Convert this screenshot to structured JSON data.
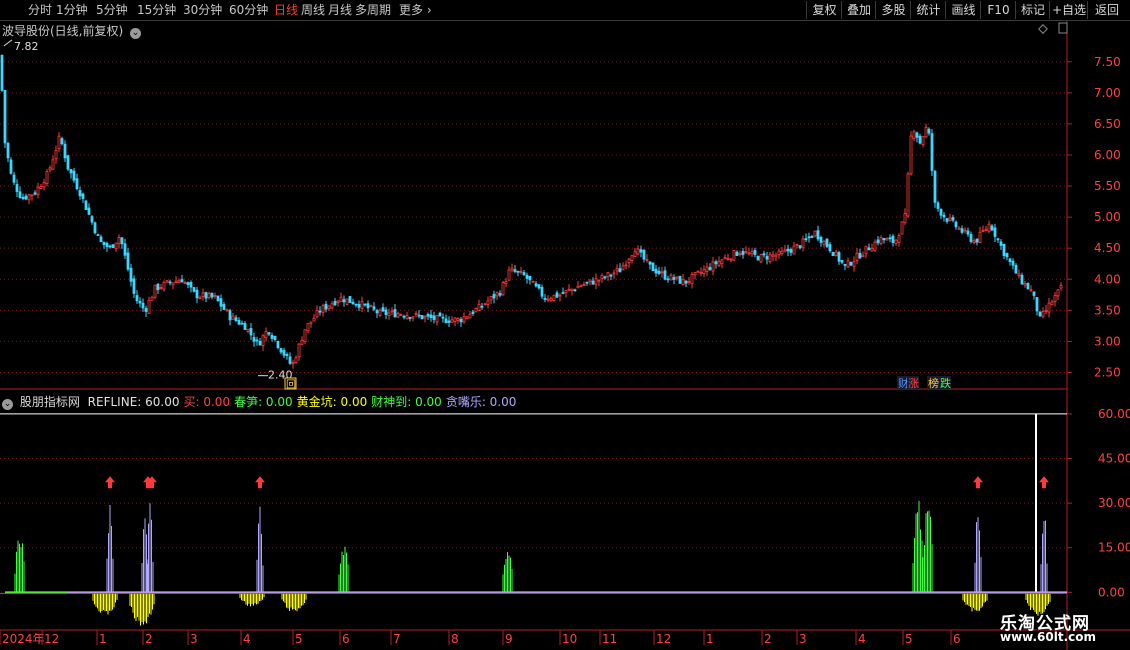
{
  "toolbar": {
    "periods": [
      {
        "label": "分时",
        "active": false
      },
      {
        "label": "1分钟",
        "active": false
      },
      {
        "label": "5分钟",
        "active": false
      },
      {
        "label": "15分钟",
        "active": false
      },
      {
        "label": "30分钟",
        "active": false
      },
      {
        "label": "60分钟",
        "active": false
      },
      {
        "label": "日线",
        "active": true
      },
      {
        "label": "周线",
        "active": false
      },
      {
        "label": "月线",
        "active": false
      },
      {
        "label": "多周期",
        "active": false
      },
      {
        "label": "更多",
        "active": false
      }
    ],
    "actions": [
      "复权",
      "叠加",
      "多股",
      "统计",
      "画线",
      "F10",
      "标记",
      "+自选",
      "返回"
    ],
    "more_icon": "chevron-right-icon"
  },
  "main_panel": {
    "title": "波导股份(日线,前复权)",
    "high_label": "7.82",
    "low_label": "2.40",
    "low_marker": "回",
    "badges": [
      {
        "label": "财",
        "color": "#4f9bff"
      },
      {
        "label": "涨",
        "color": "#ff4040"
      },
      {
        "label": "榜",
        "color": "#ffd040"
      },
      {
        "label": "跌",
        "color": "#40ff40"
      }
    ],
    "y_ticks": [
      "7.50",
      "7.00",
      "6.50",
      "6.00",
      "5.50",
      "5.00",
      "4.50",
      "4.00",
      "3.50",
      "3.00",
      "2.50"
    ]
  },
  "indicator_panel": {
    "name": "股朋指标网",
    "params": [
      {
        "label": "REFLINE: 60.00",
        "color": "#e0e0e0"
      },
      {
        "label": "买: 0.00",
        "color": "#ff4040"
      },
      {
        "label": "春笋: 0.00",
        "color": "#40ff40"
      },
      {
        "label": "黄金坑: 0.00",
        "color": "#ffff00"
      },
      {
        "label": "财神到: 0.00",
        "color": "#40ff40"
      },
      {
        "label": "贪嘴乐: 0.00",
        "color": "#b0a8ff"
      }
    ],
    "y_ticks": [
      "60.00",
      "45.00",
      "30.00",
      "15.00",
      "0.00"
    ]
  },
  "time_axis": {
    "labels": [
      "2024年",
      "12",
      "1",
      "2",
      "3",
      "4",
      "5",
      "6",
      "7",
      "8",
      "9",
      "10",
      "11",
      "12",
      "1",
      "2",
      "3",
      "4",
      "5",
      "6"
    ]
  },
  "watermark": {
    "line1": "乐淘公式网",
    "line2": "www.60lt.com"
  },
  "colors": {
    "up": "#ff3a3a",
    "down": "#3ad7ff",
    "grid": "#7a1a1a",
    "axis": "#b02020",
    "ma": "#ffffff"
  },
  "chart_data": [
    {
      "type": "candlestick",
      "title": "波导股份(日线,前复权)",
      "ylim": [
        2.25,
        7.85
      ],
      "annotations": {
        "high": 7.82,
        "low": 2.4
      },
      "close_path": [
        [
          0,
          7.6
        ],
        [
          5,
          6.2
        ],
        [
          12,
          5.6
        ],
        [
          22,
          5.3
        ],
        [
          35,
          5.4
        ],
        [
          48,
          5.7
        ],
        [
          60,
          6.3
        ],
        [
          68,
          5.8
        ],
        [
          80,
          5.4
        ],
        [
          90,
          5.0
        ],
        [
          100,
          4.6
        ],
        [
          110,
          4.5
        ],
        [
          120,
          4.7
        ],
        [
          135,
          3.7
        ],
        [
          145,
          3.5
        ],
        [
          155,
          3.85
        ],
        [
          170,
          3.95
        ],
        [
          182,
          4.0
        ],
        [
          195,
          3.75
        ],
        [
          215,
          3.7
        ],
        [
          230,
          3.4
        ],
        [
          245,
          3.25
        ],
        [
          258,
          2.95
        ],
        [
          268,
          3.2
        ],
        [
          282,
          2.85
        ],
        [
          292,
          2.6
        ],
        [
          305,
          3.2
        ],
        [
          320,
          3.5
        ],
        [
          340,
          3.7
        ],
        [
          360,
          3.6
        ],
        [
          380,
          3.45
        ],
        [
          400,
          3.45
        ],
        [
          420,
          3.4
        ],
        [
          440,
          3.35
        ],
        [
          460,
          3.35
        ],
        [
          480,
          3.55
        ],
        [
          500,
          3.8
        ],
        [
          510,
          4.15
        ],
        [
          525,
          4.05
        ],
        [
          545,
          3.7
        ],
        [
          560,
          3.75
        ],
        [
          580,
          3.9
        ],
        [
          600,
          4.0
        ],
        [
          620,
          4.15
        ],
        [
          635,
          4.5
        ],
        [
          650,
          4.2
        ],
        [
          665,
          4.05
        ],
        [
          685,
          3.95
        ],
        [
          700,
          4.1
        ],
        [
          720,
          4.3
        ],
        [
          740,
          4.45
        ],
        [
          760,
          4.35
        ],
        [
          780,
          4.4
        ],
        [
          800,
          4.55
        ],
        [
          815,
          4.75
        ],
        [
          830,
          4.5
        ],
        [
          845,
          4.2
        ],
        [
          860,
          4.4
        ],
        [
          880,
          4.65
        ],
        [
          895,
          4.6
        ],
        [
          905,
          5.0
        ],
        [
          912,
          6.5
        ],
        [
          920,
          6.2
        ],
        [
          928,
          6.5
        ],
        [
          935,
          5.2
        ],
        [
          945,
          5.0
        ],
        [
          960,
          4.8
        ],
        [
          975,
          4.6
        ],
        [
          990,
          4.9
        ],
        [
          1005,
          4.4
        ],
        [
          1020,
          4.0
        ],
        [
          1032,
          3.8
        ],
        [
          1040,
          3.35
        ],
        [
          1050,
          3.6
        ],
        [
          1063,
          3.9
        ]
      ]
    },
    {
      "type": "area",
      "title": "股朋指标网",
      "ylim": [
        -12,
        63
      ],
      "refline": 60,
      "series": [
        {
          "name": "买",
          "color": "#ff3a3a",
          "markers_x": [
            110,
            148,
            152,
            260,
            978,
            1044
          ]
        },
        {
          "name": "春笋",
          "color": "#40ff40",
          "peaks": [
            [
              20,
              20
            ],
            [
              344,
              16
            ],
            [
              508,
              16
            ],
            [
              918,
              32
            ],
            [
              928,
              30
            ]
          ]
        },
        {
          "name": "黄金坑",
          "color": "#ffff00",
          "troughs": [
            [
              105,
              -8
            ],
            [
              142,
              -12
            ],
            [
              252,
              -5
            ],
            [
              294,
              -7
            ],
            [
              975,
              -7
            ],
            [
              1038,
              -8
            ]
          ]
        },
        {
          "name": "贪嘴乐",
          "color": "#b0a8ff",
          "peaks": [
            [
              110,
              30
            ],
            [
              145,
              30
            ],
            [
              150,
              30
            ],
            [
              260,
              30
            ],
            [
              978,
              30
            ],
            [
              1044,
              30
            ]
          ]
        }
      ]
    }
  ]
}
